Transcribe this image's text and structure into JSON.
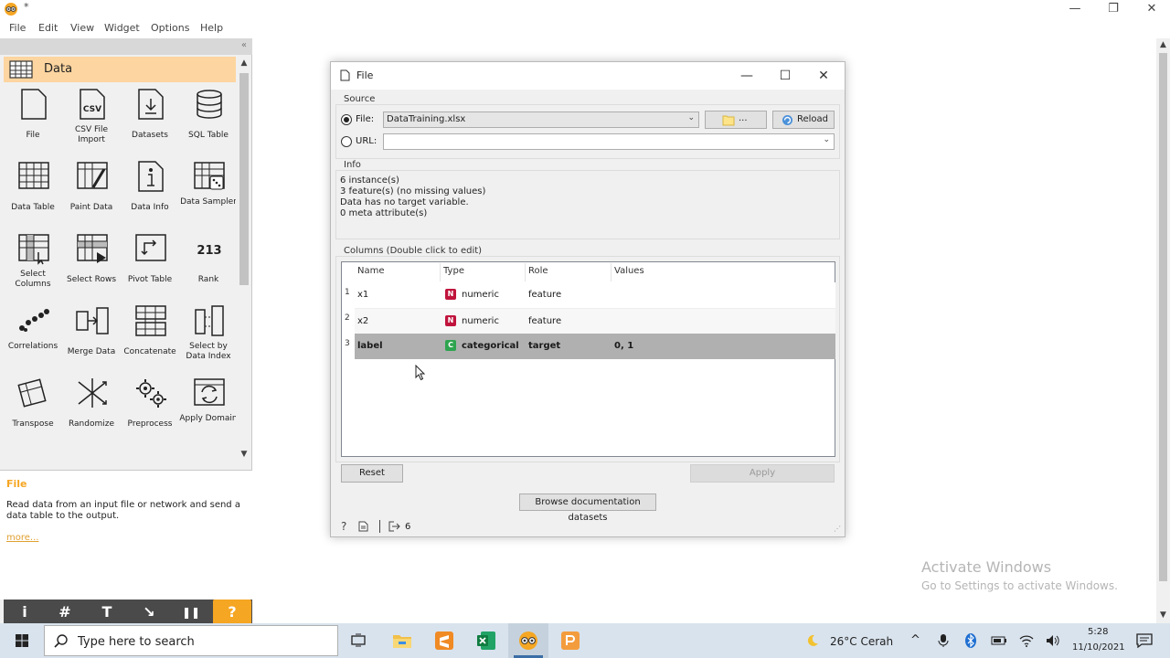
{
  "app": {
    "title_marker": "*"
  },
  "menu": [
    "File",
    "Edit",
    "View",
    "Widget",
    "Options",
    "Help"
  ],
  "category": {
    "label": "Data",
    "color": "#fdd5a0"
  },
  "widgets": [
    {
      "label": "File",
      "icon": "file-icon"
    },
    {
      "label": "CSV File Import",
      "icon": "csv-icon"
    },
    {
      "label": "Datasets",
      "icon": "datasets-icon"
    },
    {
      "label": "SQL Table",
      "icon": "database-icon"
    },
    {
      "label": "Data Table",
      "icon": "table-icon"
    },
    {
      "label": "Paint Data",
      "icon": "paint-icon"
    },
    {
      "label": "Data Info",
      "icon": "info-icon"
    },
    {
      "label": "Data Sampler",
      "icon": "sampler-icon"
    },
    {
      "label": "Select Columns",
      "icon": "select-columns-icon"
    },
    {
      "label": "Select Rows",
      "icon": "select-rows-icon"
    },
    {
      "label": "Pivot Table",
      "icon": "pivot-icon"
    },
    {
      "label": "Rank",
      "icon": "rank-icon"
    },
    {
      "label": "Correlations",
      "icon": "correlations-icon"
    },
    {
      "label": "Merge Data",
      "icon": "merge-icon"
    },
    {
      "label": "Concatenate",
      "icon": "concatenate-icon"
    },
    {
      "label": "Select by Data Index",
      "icon": "select-index-icon"
    },
    {
      "label": "Transpose",
      "icon": "transpose-icon"
    },
    {
      "label": "Randomize",
      "icon": "randomize-icon"
    },
    {
      "label": "Preprocess",
      "icon": "preprocess-icon"
    },
    {
      "label": "Apply Domain",
      "icon": "apply-domain-icon"
    }
  ],
  "description": {
    "title": "File",
    "text": "Read data from an input file or network and send a data table to the output.",
    "more": "more..."
  },
  "toolbar": [
    {
      "label": "i",
      "icon": "info-toggle-icon"
    },
    {
      "label": "#",
      "icon": "grid-icon"
    },
    {
      "label": "T",
      "icon": "text-annotation-icon"
    },
    {
      "label": "↘",
      "icon": "arrow-annotation-icon"
    },
    {
      "label": "❚❚",
      "icon": "pause-icon"
    },
    {
      "label": "?",
      "icon": "help-icon"
    }
  ],
  "dialog": {
    "title": "File",
    "source_title": "Source",
    "file_label": "File:",
    "file_value": "DataTraining.xlsx",
    "browse_label": "...",
    "reload_label": "Reload",
    "url_label": "URL:",
    "url_value": "",
    "info_title": "Info",
    "info_lines": [
      "6 instance(s)",
      "3 feature(s) (no missing values)",
      "Data has no target variable.",
      "0 meta attribute(s)"
    ],
    "columns_title": "Columns (Double click to edit)",
    "headers": [
      "Name",
      "Type",
      "Role",
      "Values"
    ],
    "rows": [
      {
        "num": "1",
        "name": "x1",
        "badge": "N",
        "badge_color": "#c0143c",
        "type": "numeric",
        "role": "feature",
        "values": ""
      },
      {
        "num": "2",
        "name": "x2",
        "badge": "N",
        "badge_color": "#c0143c",
        "type": "numeric",
        "role": "feature",
        "values": ""
      },
      {
        "num": "3",
        "name": "label",
        "badge": "C",
        "badge_color": "#2ea44f",
        "type": "categorical",
        "role": "target",
        "values": "0, 1"
      }
    ],
    "reset_label": "Reset",
    "apply_label": "Apply",
    "browse_docs_label": "Browse documentation datasets",
    "output_count": "6"
  },
  "watermark": {
    "line1": "Activate Windows",
    "line2": "Go to Settings to activate Windows."
  },
  "taskbar": {
    "search_placeholder": "Type here to search",
    "weather": "26°C  Cerah",
    "time": "5:28",
    "date": "11/10/2021"
  }
}
